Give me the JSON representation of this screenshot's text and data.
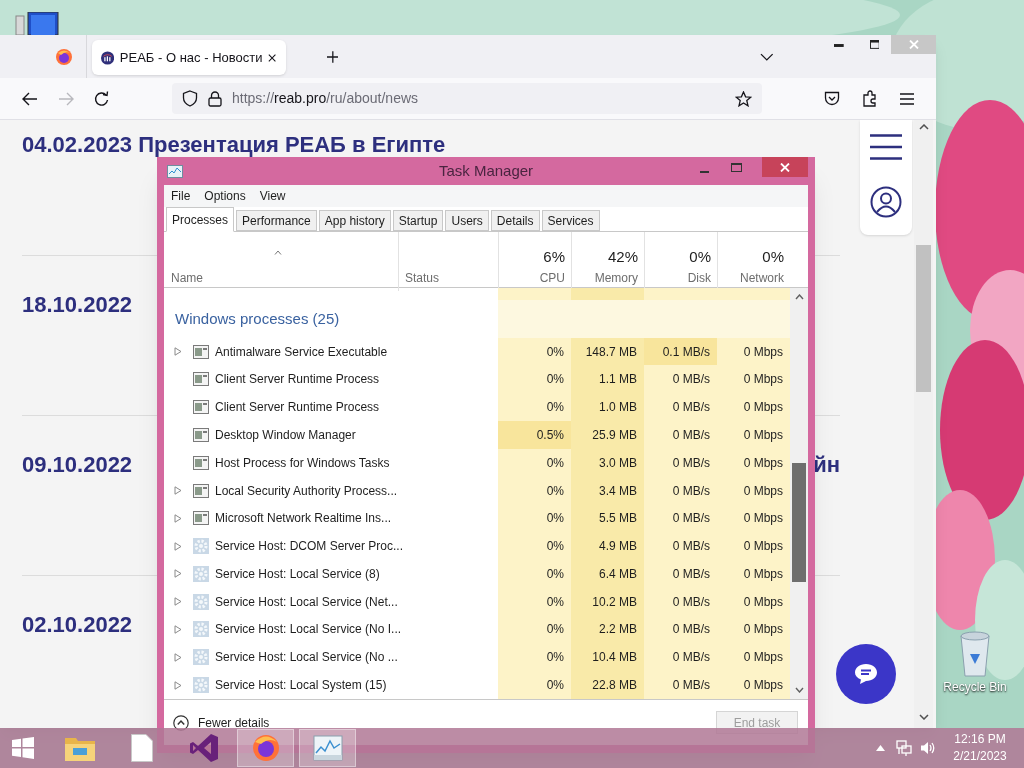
{
  "desktop": {
    "recycle_bin": {
      "label": "Recycle Bin"
    }
  },
  "browser": {
    "tabs": [
      {
        "title": "РЕАБ - О нас - Новости",
        "selected": true
      }
    ],
    "url": {
      "scheme": "https://",
      "domain": "reab.pro",
      "path": "/ru/about/news"
    },
    "news": [
      {
        "headline": "04.02.2023 Презентация РЕАБ в Египте"
      },
      {
        "headline": "18.10.2022"
      },
      {
        "headline": "09.10.2022",
        "tail": "йн"
      },
      {
        "headline": "02.10.2022"
      }
    ]
  },
  "task_manager": {
    "title": "Task Manager",
    "menu": [
      "File",
      "Options",
      "View"
    ],
    "tabs": [
      {
        "label": "Processes",
        "selected": true
      },
      {
        "label": "Performance",
        "selected": false
      },
      {
        "label": "App history",
        "selected": false
      },
      {
        "label": "Startup",
        "selected": false
      },
      {
        "label": "Users",
        "selected": false
      },
      {
        "label": "Details",
        "selected": false
      },
      {
        "label": "Services",
        "selected": false
      }
    ],
    "columns": [
      {
        "label": "Name"
      },
      {
        "label": "Status"
      },
      {
        "label": "CPU",
        "usage": "6%"
      },
      {
        "label": "Memory",
        "usage": "42%"
      },
      {
        "label": "Disk",
        "usage": "0%"
      },
      {
        "label": "Network",
        "usage": "0%"
      }
    ],
    "group": "Windows processes (25)",
    "rows": [
      {
        "name": "Antimalware Service Executable",
        "kind": "app",
        "expandable": true,
        "cpu": "0%",
        "memory": "148.7 MB",
        "disk": "0.1 MB/s",
        "network": "0 Mbps",
        "cpu_high": false,
        "disk_high": true
      },
      {
        "name": "Client Server Runtime Process",
        "kind": "app",
        "expandable": false,
        "cpu": "0%",
        "memory": "1.1 MB",
        "disk": "0 MB/s",
        "network": "0 Mbps",
        "cpu_high": false,
        "disk_high": false
      },
      {
        "name": "Client Server Runtime Process",
        "kind": "app",
        "expandable": false,
        "cpu": "0%",
        "memory": "1.0 MB",
        "disk": "0 MB/s",
        "network": "0 Mbps",
        "cpu_high": false,
        "disk_high": false
      },
      {
        "name": "Desktop Window Manager",
        "kind": "app",
        "expandable": false,
        "cpu": "0.5%",
        "memory": "25.9 MB",
        "disk": "0 MB/s",
        "network": "0 Mbps",
        "cpu_high": true,
        "disk_high": false
      },
      {
        "name": "Host Process for Windows Tasks",
        "kind": "app",
        "expandable": false,
        "cpu": "0%",
        "memory": "3.0 MB",
        "disk": "0 MB/s",
        "network": "0 Mbps",
        "cpu_high": false,
        "disk_high": false
      },
      {
        "name": "Local Security Authority Process...",
        "kind": "app",
        "expandable": true,
        "cpu": "0%",
        "memory": "3.4 MB",
        "disk": "0 MB/s",
        "network": "0 Mbps",
        "cpu_high": false,
        "disk_high": false
      },
      {
        "name": "Microsoft Network Realtime Ins...",
        "kind": "app",
        "expandable": true,
        "cpu": "0%",
        "memory": "5.5 MB",
        "disk": "0 MB/s",
        "network": "0 Mbps",
        "cpu_high": false,
        "disk_high": false
      },
      {
        "name": "Service Host: DCOM Server Proc...",
        "kind": "service",
        "expandable": true,
        "cpu": "0%",
        "memory": "4.9 MB",
        "disk": "0 MB/s",
        "network": "0 Mbps",
        "cpu_high": false,
        "disk_high": false
      },
      {
        "name": "Service Host: Local Service (8)",
        "kind": "service",
        "expandable": true,
        "cpu": "0%",
        "memory": "6.4 MB",
        "disk": "0 MB/s",
        "network": "0 Mbps",
        "cpu_high": false,
        "disk_high": false
      },
      {
        "name": "Service Host: Local Service (Net...",
        "kind": "service",
        "expandable": true,
        "cpu": "0%",
        "memory": "10.2 MB",
        "disk": "0 MB/s",
        "network": "0 Mbps",
        "cpu_high": false,
        "disk_high": false
      },
      {
        "name": "Service Host: Local Service (No I...",
        "kind": "service",
        "expandable": true,
        "cpu": "0%",
        "memory": "2.2 MB",
        "disk": "0 MB/s",
        "network": "0 Mbps",
        "cpu_high": false,
        "disk_high": false
      },
      {
        "name": "Service Host: Local Service (No ...",
        "kind": "service",
        "expandable": true,
        "cpu": "0%",
        "memory": "10.4 MB",
        "disk": "0 MB/s",
        "network": "0 Mbps",
        "cpu_high": false,
        "disk_high": false
      },
      {
        "name": "Service Host: Local System (15)",
        "kind": "service",
        "expandable": true,
        "cpu": "0%",
        "memory": "22.8 MB",
        "disk": "0 MB/s",
        "network": "0 Mbps",
        "cpu_high": false,
        "disk_high": false
      }
    ],
    "footer": {
      "details": "Fewer details",
      "end_task": {
        "label": "End task",
        "disabled": true
      }
    }
  },
  "taskbar": {
    "apps": [
      {
        "kind": "explorer",
        "active": false
      },
      {
        "kind": "document",
        "active": false
      },
      {
        "kind": "visual-studio",
        "active": false
      },
      {
        "kind": "firefox",
        "active": true
      },
      {
        "kind": "task-manager",
        "active": true
      }
    ],
    "time": "12:16 PM",
    "date": "2/21/2023"
  }
}
